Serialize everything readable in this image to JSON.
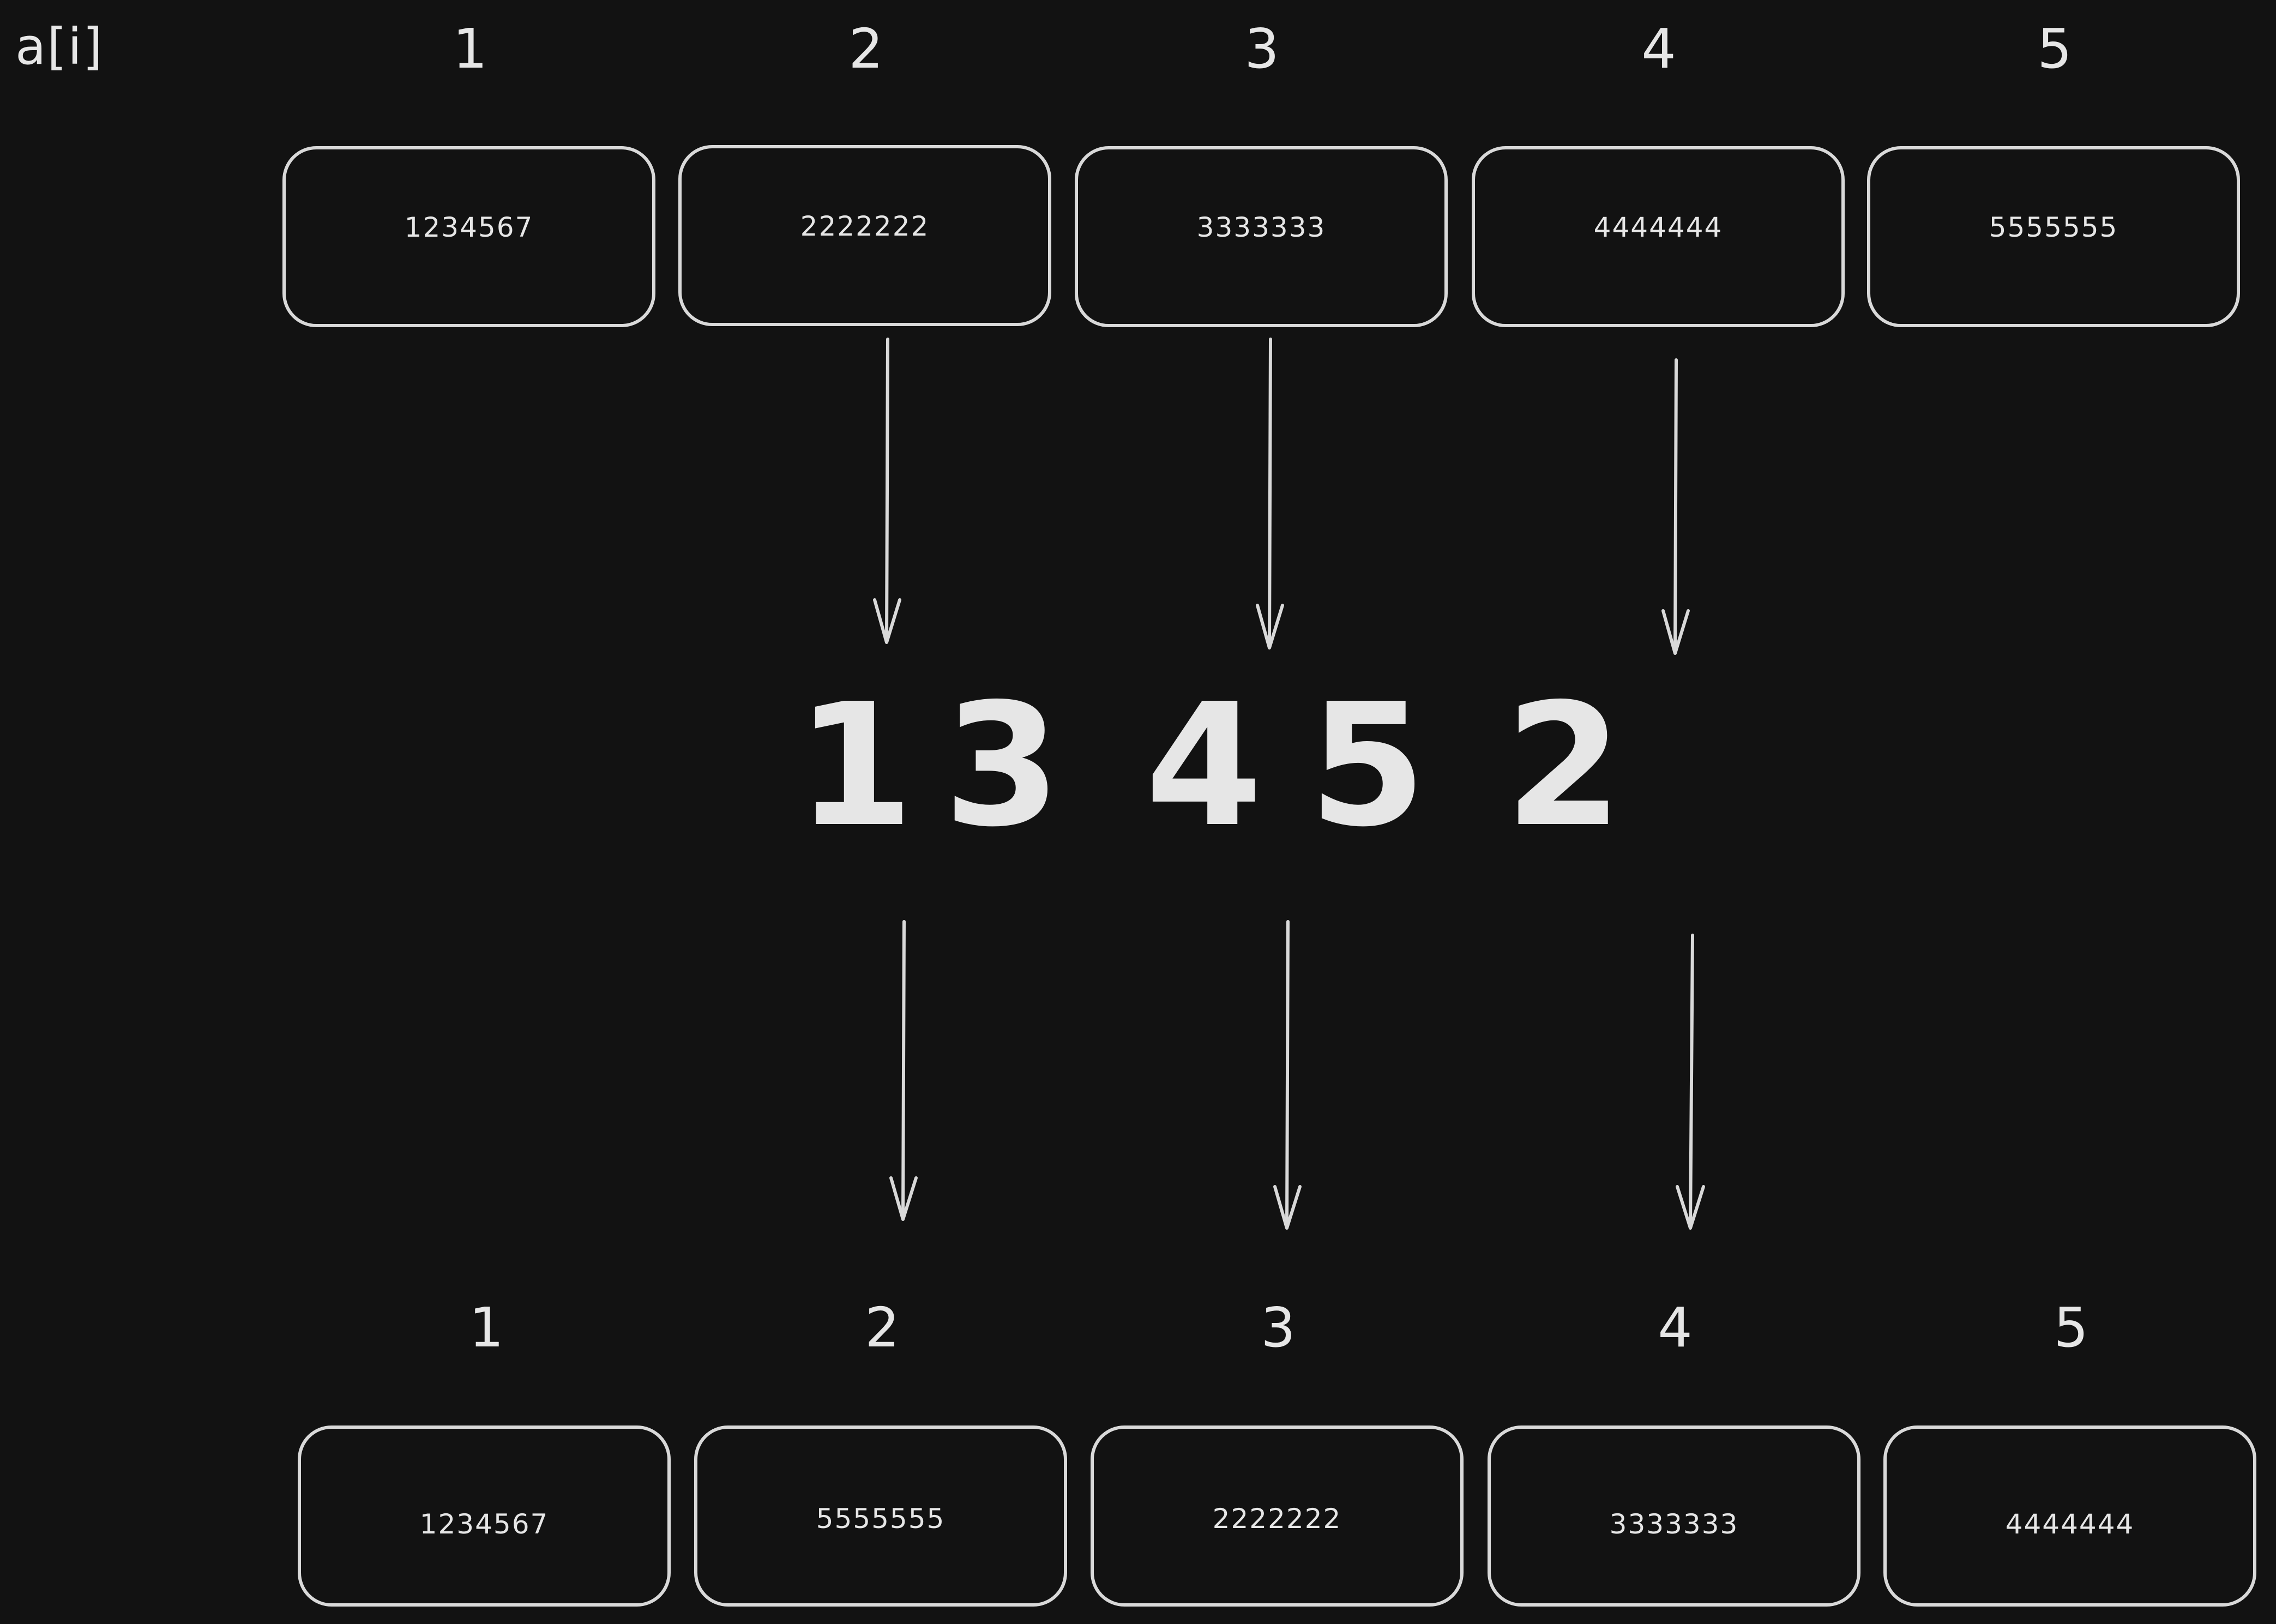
{
  "array_label": "a[i]",
  "top_indices": [
    "1",
    "2",
    "3",
    "4",
    "5"
  ],
  "top_values": [
    "1234567",
    "2222222",
    "3333333",
    "4444444",
    "5555555"
  ],
  "permutation": [
    "1",
    "3",
    "4",
    "5",
    "2"
  ],
  "bottom_indices": [
    "1",
    "2",
    "3",
    "4",
    "5"
  ],
  "bottom_values": [
    "1234567",
    "5555555",
    "2222222",
    "3333333",
    "4444444"
  ],
  "colors": {
    "background": "#121212",
    "stroke": "#d9d9d9",
    "text": "#e6e6e6"
  }
}
